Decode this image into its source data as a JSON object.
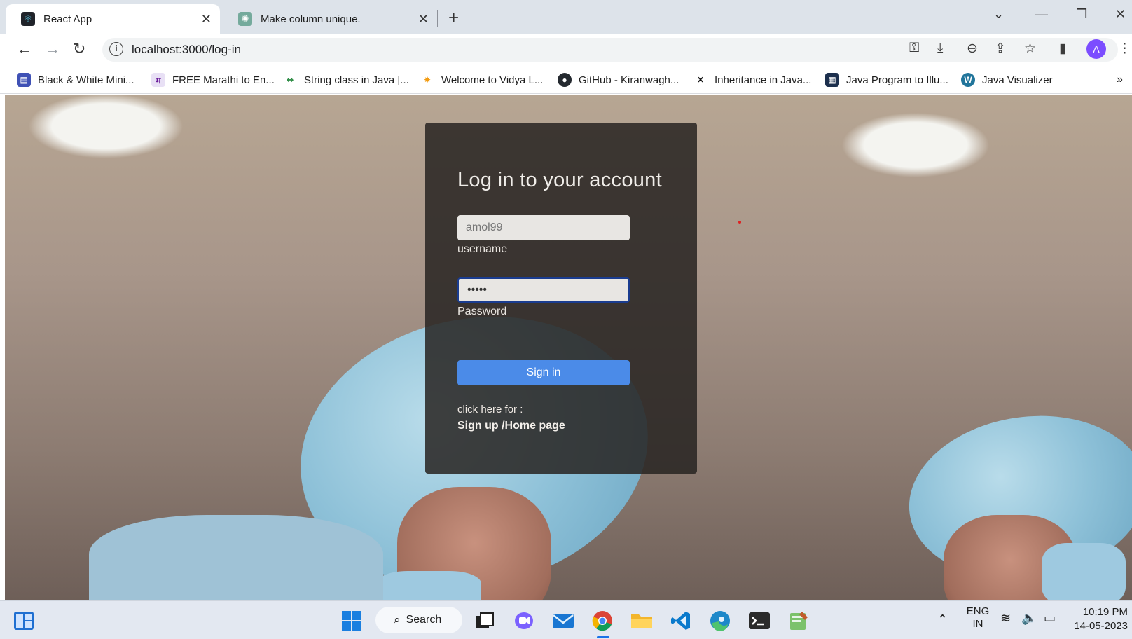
{
  "browser": {
    "tabs": [
      {
        "title": "React App",
        "active": true
      },
      {
        "title": "Make column unique.",
        "active": false
      }
    ],
    "url": "localhost:3000/log-in",
    "avatar_letter": "A",
    "bookmarks": [
      {
        "label": "Black & White Mini...",
        "icon": "printer-icon"
      },
      {
        "label": "FREE Marathi to En...",
        "icon": "marathi-ma-icon"
      },
      {
        "label": "String class in Java |...",
        "icon": "geeksforgeeks-icon"
      },
      {
        "label": "Welcome to Vidya L...",
        "icon": "vidya-icon"
      },
      {
        "label": "GitHub - Kiranwagh...",
        "icon": "github-icon"
      },
      {
        "label": "Inheritance in Java...",
        "icon": "javatpoint-icon"
      },
      {
        "label": "Java Program to Illu...",
        "icon": "java-program-icon"
      },
      {
        "label": "Java Visualizer",
        "icon": "wordpress-icon"
      }
    ]
  },
  "login": {
    "title": "Log in to your account",
    "username_value": "amol99",
    "username_label": "username",
    "password_value": "•••••",
    "password_label": "Password",
    "signin_label": "Sign in",
    "click_here": "click here for :",
    "signup_link": "Sign up /Home page"
  },
  "taskbar": {
    "search_label": "Search",
    "lang_line1": "ENG",
    "lang_line2": "IN",
    "time": "10:19 PM",
    "date": "14-05-2023"
  },
  "colors": {
    "accent_button": "#4b8be8",
    "card_bg": "#282422",
    "avatar": "#7c4dff"
  }
}
